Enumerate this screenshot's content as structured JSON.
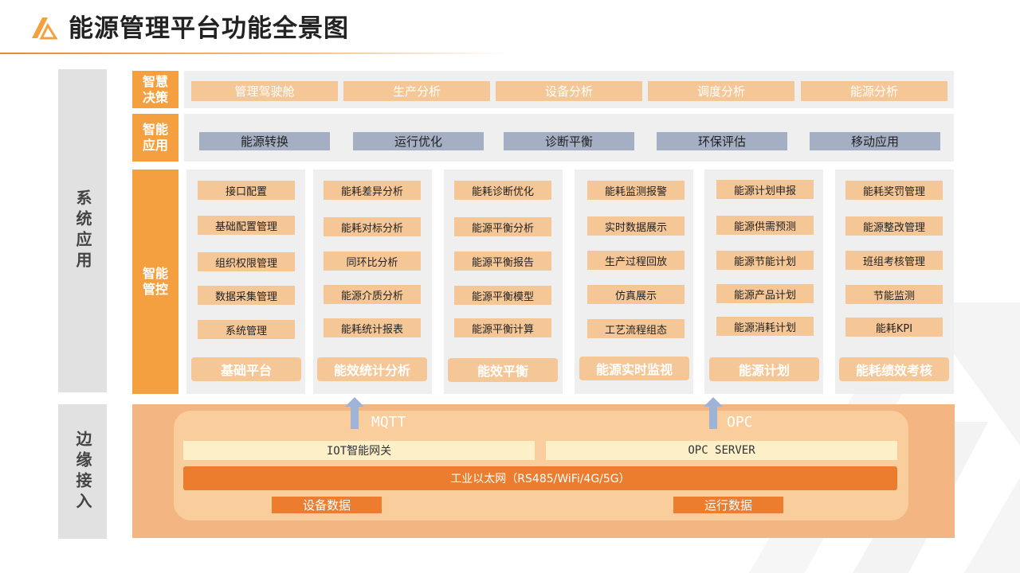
{
  "header": {
    "title": "能源管理平台功能全景图"
  },
  "side_labels": {
    "system_app": "系统应用",
    "edge_access": "边缘接入"
  },
  "rows": {
    "decision": {
      "label": "智慧决策",
      "items": [
        "管理驾驶舱",
        "生产分析",
        "设备分析",
        "调度分析",
        "能源分析"
      ]
    },
    "application": {
      "label": "智能应用",
      "items": [
        "能源转换",
        "运行优化",
        "诊断平衡",
        "环保评估",
        "移动应用"
      ]
    },
    "control": {
      "label": "智能管控"
    }
  },
  "columns": [
    {
      "title": "基础平台",
      "items": [
        "接口配置",
        "基础配置管理",
        "组织权限管理",
        "数据采集管理",
        "系统管理"
      ]
    },
    {
      "title": "能效统计分析",
      "items": [
        "能耗差异分析",
        "能耗对标分析",
        "同环比分析",
        "能源介质分析",
        "能耗统计报表"
      ]
    },
    {
      "title": "能效平衡",
      "items": [
        "能耗诊断优化",
        "能源平衡分析",
        "能源平衡报告",
        "能源平衡模型",
        "能源平衡计算"
      ]
    },
    {
      "title": "能源实时监视",
      "items": [
        "能耗监测报警",
        "实时数据展示",
        "生产过程回放",
        "仿真展示",
        "工艺流程组态"
      ]
    },
    {
      "title": "能源计划",
      "items": [
        "能源计划申报",
        "能源供需预测",
        "能源节能计划",
        "能源产品计划",
        "能源消耗计划"
      ]
    },
    {
      "title": "能耗绩效考核",
      "items": [
        "能耗奖罚管理",
        "能源整改管理",
        "班组考核管理",
        "节能监测",
        "能耗KPI"
      ]
    }
  ],
  "edge": {
    "protocols": [
      "MQTT",
      "OPC"
    ],
    "gateways": [
      "IOT智能网关",
      "OPC SERVER"
    ],
    "network": "工业以太网（RS485/WiFi/4G/5G）",
    "data": [
      "设备数据",
      "运行数据"
    ]
  },
  "colors": {
    "accent_orange": "#f5a040",
    "peach": "#f6c796",
    "slate": "#a5afc3",
    "deep_orange": "#ec7c2e",
    "panel_grey": "#efefef",
    "arrow_blue": "#9fb3d6"
  }
}
